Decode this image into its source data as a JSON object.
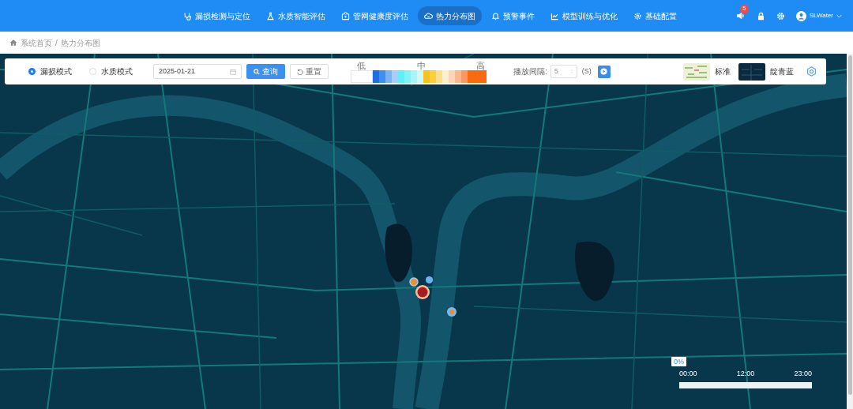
{
  "nav": {
    "items": [
      {
        "label": "漏损检测与定位",
        "selected": false
      },
      {
        "label": "水质智能评估",
        "selected": false
      },
      {
        "label": "管网健康度评估",
        "selected": false
      },
      {
        "label": "热力分布图",
        "selected": true
      },
      {
        "label": "预警事件",
        "selected": false
      },
      {
        "label": "模型训练与优化",
        "selected": false
      },
      {
        "label": "基础配置",
        "selected": false
      }
    ],
    "notification_count": "5",
    "user": "SLWater"
  },
  "breadcrumb": [
    "系统首页",
    "/",
    "热力分布图"
  ],
  "toolbar": {
    "modes": [
      {
        "label": "漏损模式",
        "selected": true
      },
      {
        "label": "水质模式",
        "selected": false
      }
    ],
    "date": "2025-01-21",
    "query_button": "查询",
    "reset_button": "重置",
    "legend": {
      "labels": [
        "低",
        "中",
        "高"
      ],
      "cells": [
        {
          "color": "#1f6fe0"
        },
        {
          "color": "#3d8ff0"
        },
        {
          "color": "#78b4f5"
        },
        {
          "color": "#a9cdf8"
        },
        {
          "color": "#5ff0f5"
        },
        {
          "color": "#7ef4f6"
        },
        {
          "color": "#a5f7f7"
        },
        {
          "color": "#ccfafa"
        },
        {
          "color": "#f7c21c"
        },
        {
          "color": "#f9cf3d"
        },
        {
          "color": "#fbe08a"
        },
        {
          "color": "#fdf0d0"
        },
        {
          "color": "#fbd6b5"
        },
        {
          "color": "#f8b88c"
        },
        {
          "color": "#f59a63"
        },
        {
          "color": "#fb6a10"
        },
        {
          "color": "#fb6a10"
        },
        {
          "color": "#fb6a10"
        }
      ]
    },
    "interval_label": "播放间隔:",
    "interval_value": "5",
    "interval_unit": "(S)",
    "basemaps": [
      {
        "label": "标准",
        "kind": "standard"
      },
      {
        "label": "靛青蓝",
        "kind": "indigo"
      }
    ]
  },
  "timeline": {
    "tooltip": "0%",
    "ticks": [
      "00:00",
      "12:00",
      "23:00"
    ],
    "level": 0
  }
}
